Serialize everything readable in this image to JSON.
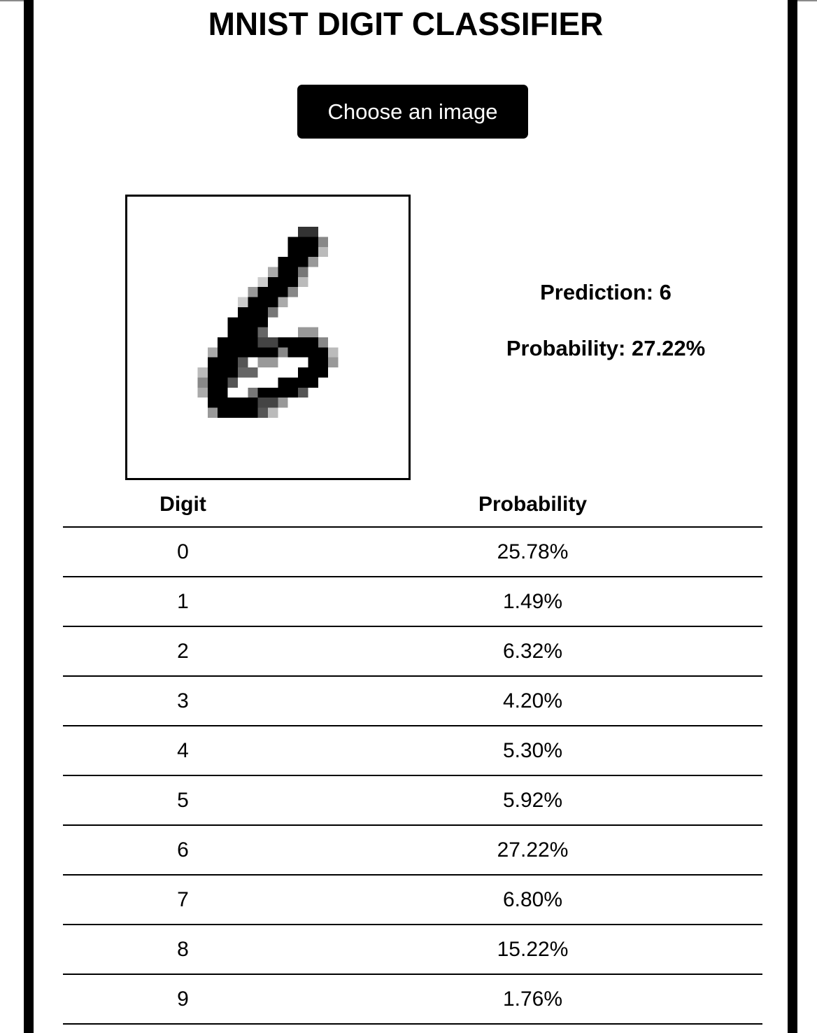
{
  "title": "MNIST DIGIT CLASSIFIER",
  "upload": {
    "button_label": "Choose an image"
  },
  "prediction": {
    "label": "Prediction: 6",
    "probability": "Probability: 27.22%"
  },
  "table": {
    "headers": [
      "Digit",
      "Probability"
    ],
    "rows": [
      [
        "0",
        "25.78%"
      ],
      [
        "1",
        "1.49%"
      ],
      [
        "2",
        "6.32%"
      ],
      [
        "3",
        "4.20%"
      ],
      [
        "4",
        "5.30%"
      ],
      [
        "5",
        "5.92%"
      ],
      [
        "6",
        "27.22%"
      ],
      [
        "7",
        "6.80%"
      ],
      [
        "8",
        "15.22%"
      ],
      [
        "9",
        "1.76%"
      ]
    ]
  },
  "colors": {
    "frame": "#000000",
    "button_bg": "#000000",
    "button_text": "#ffffff",
    "background": "#ffffff"
  }
}
